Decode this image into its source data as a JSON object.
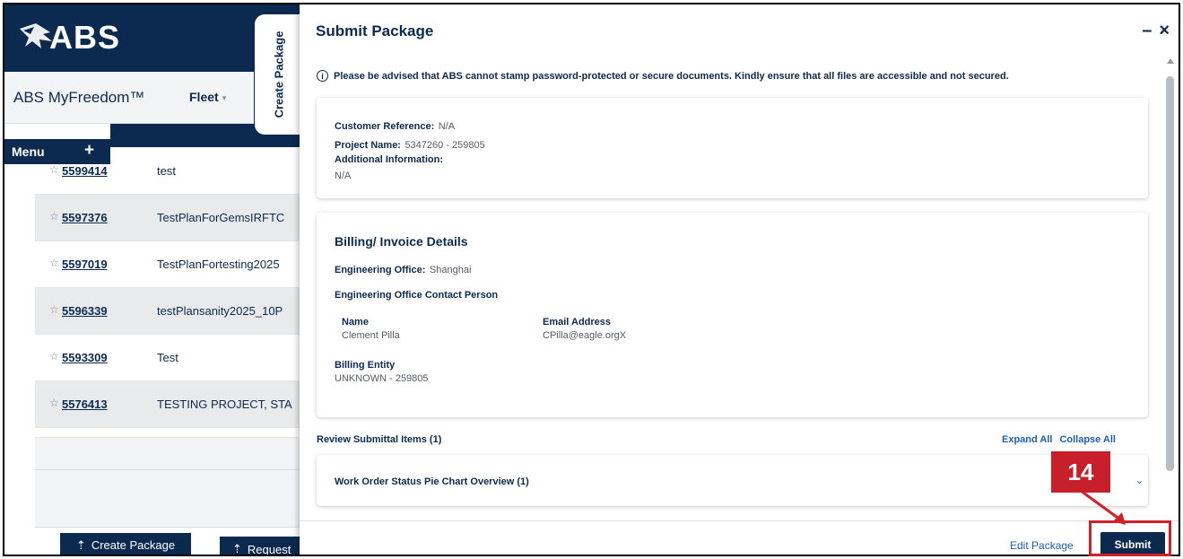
{
  "app": {
    "logo_text": "ABS",
    "brand": "ABS MyFreedom™",
    "fleet_label": "Fleet",
    "menu_label": "Menu",
    "menu_plus": "+",
    "create_package_tab": "Create Package"
  },
  "project_list": [
    {
      "id": "5599414",
      "name": "test"
    },
    {
      "id": "5597376",
      "name": "TestPlanForGemsIRFTC"
    },
    {
      "id": "5597019",
      "name": "TestPlanFortesting2025"
    },
    {
      "id": "5596339",
      "name": "testPlansanity2025_10P"
    },
    {
      "id": "5593309",
      "name": "Test"
    },
    {
      "id": "5576413",
      "name": "TESTING PROJECT, STA"
    }
  ],
  "footer_buttons": {
    "create_package": "Create Package",
    "request": "Request"
  },
  "panel": {
    "title": "Submit Package",
    "minimize": "–",
    "close": "×",
    "notice": "Please be advised that ABS cannot stamp password-protected or secure documents. Kindly ensure that all files are accessible and not secured.",
    "info_glyph": "i",
    "customer_reference_label": "Customer Reference:",
    "customer_reference_value": "N/A",
    "project_name_label": "Project Name:",
    "project_name_value": "5347260 - 259805",
    "additional_info_label": "Additional Information:",
    "additional_info_value": "N/A",
    "billing_title": "Billing/ Invoice Details",
    "engineering_office_label": "Engineering Office:",
    "engineering_office_value": "Shanghai",
    "contact_person_label": "Engineering Office Contact Person",
    "name_header": "Name",
    "name_value": "Clement Pilla",
    "email_header": "Email Address",
    "email_value": "CPilla@eagle.orgX",
    "billing_entity_label": "Billing Entity",
    "billing_entity_value": "UNKNOWN - 259805",
    "review_title": "Review Submittal Items (1)",
    "expand_all": "Expand All",
    "collapse_all": "Collapse All",
    "item_title": "Work Order Status Pie Chart Overview (1)",
    "edit_package": "Edit Package",
    "submit": "Submit"
  },
  "annotation": {
    "step_number": "14",
    "color": "#d21f28"
  }
}
